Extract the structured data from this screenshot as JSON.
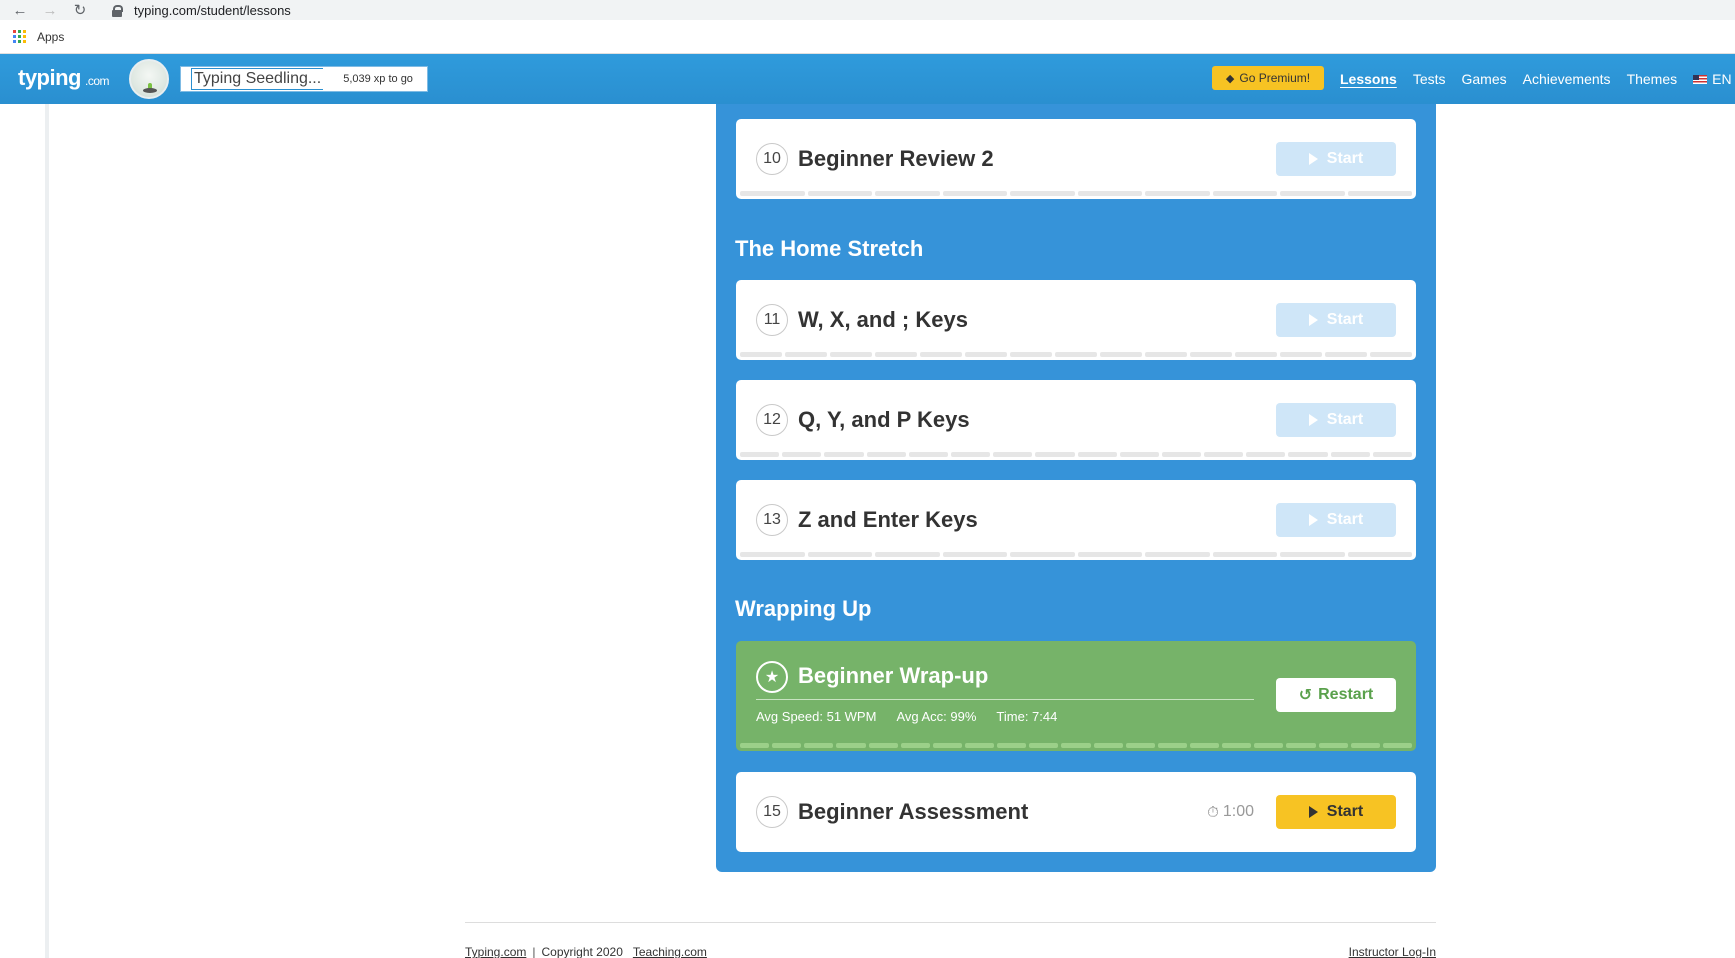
{
  "browser": {
    "url": "typing.com/student/lessons",
    "bookmark_apps": "Apps"
  },
  "header": {
    "logo_main": "typing",
    "logo_suffix": ".com",
    "level": "Typing Seedling...",
    "xp_to_go": "5,039 xp to go",
    "premium_label": "Go Premium!",
    "nav": [
      "Lessons",
      "Tests",
      "Games",
      "Achievements",
      "Themes"
    ],
    "language": "EN"
  },
  "sections": {
    "review_card": {
      "number": "10",
      "title": "Beginner Review 2",
      "start": "Start"
    },
    "home_stretch": {
      "title": "The Home Stretch",
      "cards": [
        {
          "number": "11",
          "title": "W, X, and ; Keys",
          "start": "Start"
        },
        {
          "number": "12",
          "title": "Q, Y, and P Keys",
          "start": "Start"
        },
        {
          "number": "13",
          "title": "Z and Enter Keys",
          "start": "Start"
        }
      ]
    },
    "wrapping_up": {
      "title": "Wrapping Up",
      "wrapup": {
        "title": "Beginner Wrap-up",
        "avg_speed": "Avg Speed: 51 WPM",
        "avg_acc": "Avg Acc: 99%",
        "time": "Time: 7:44",
        "restart": "Restart"
      },
      "assessment": {
        "number": "15",
        "title": "Beginner Assessment",
        "timer": "1:00",
        "start": "Start"
      }
    }
  },
  "footer": {
    "brand": "Typing.com",
    "copyright": "Copyright 2020",
    "teaching": "Teaching.com",
    "instructor": "Instructor Log-In"
  },
  "colors": {
    "header_blue": "#2f9bdc",
    "panel_blue": "#3693d9",
    "start_yellow": "#f7c323",
    "wrapup_green": "#76b369"
  }
}
